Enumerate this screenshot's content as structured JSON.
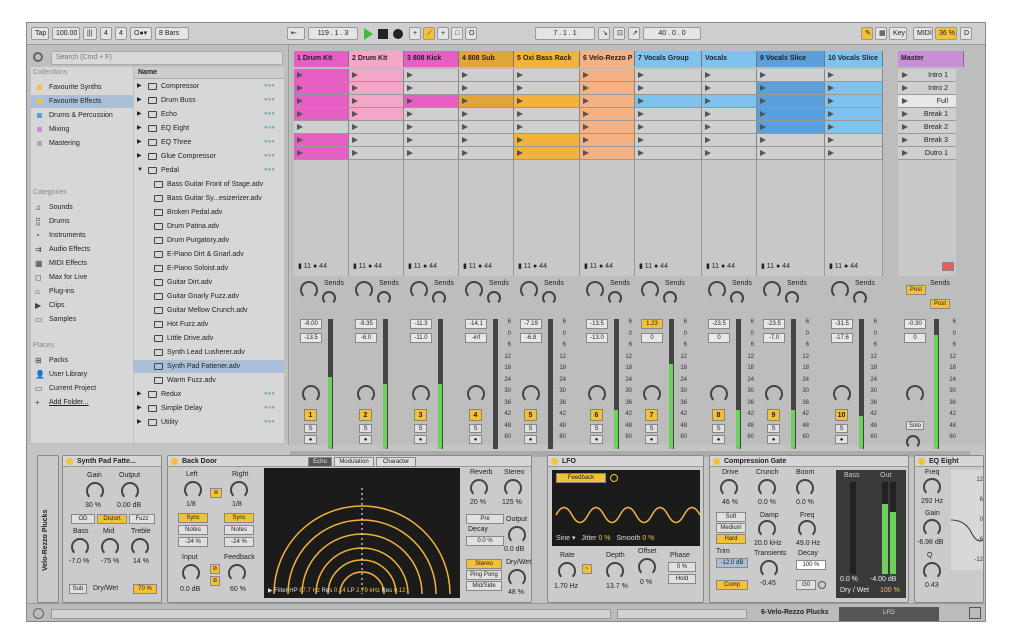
{
  "toolbar": {
    "tap": "Tap",
    "tempo": "100.00",
    "sig_num": "4",
    "sig_den": "4",
    "quant": "8 Bars",
    "pos": "119 . 1 . 3",
    "pos2": "7 . 1 . 1",
    "loop_len": "40 . 0 . 0",
    "key": "Key",
    "midi": "MIDI",
    "cpu": "36 %",
    "disk": "D"
  },
  "browser": {
    "search_placeholder": "Search (Cmd + F)",
    "collections_title": "Collections",
    "categories_title": "Categories",
    "places_title": "Places",
    "name_header": "Name",
    "collections": [
      {
        "label": "Favourite Synths",
        "color": "#f3c13a"
      },
      {
        "label": "Favourite Effects",
        "color": "#f3c13a"
      },
      {
        "label": "Drums & Percussion",
        "color": "#5aa0dc"
      },
      {
        "label": "Mixing",
        "color": "#c78fd8"
      },
      {
        "label": "Mastering",
        "color": "#aaa"
      }
    ],
    "categories": [
      "Sounds",
      "Drums",
      "Instruments",
      "Audio Effects",
      "MIDI Effects",
      "Max for Live",
      "Plug-ins",
      "Clips",
      "Samples"
    ],
    "places": [
      "Packs",
      "User Library",
      "Current Project",
      "Add Folder..."
    ],
    "files": [
      {
        "name": "Compressor",
        "lvl": 0,
        "folder": true
      },
      {
        "name": "Drum Buss",
        "lvl": 0,
        "folder": true
      },
      {
        "name": "Echo",
        "lvl": 0,
        "folder": true
      },
      {
        "name": "EQ Eight",
        "lvl": 0,
        "folder": true
      },
      {
        "name": "EQ Three",
        "lvl": 0,
        "folder": true
      },
      {
        "name": "Glue Compressor",
        "lvl": 0,
        "folder": true
      },
      {
        "name": "Pedal",
        "lvl": 0,
        "folder": true,
        "open": true
      },
      {
        "name": "Bass Guitar Front of Stage.adv",
        "lvl": 1
      },
      {
        "name": "Bass Guitar Sy...esizerizer.adv",
        "lvl": 1
      },
      {
        "name": "Broken Pedal.adv",
        "lvl": 1
      },
      {
        "name": "Drum Patina.adv",
        "lvl": 1
      },
      {
        "name": "Drum Purgatory.adv",
        "lvl": 1
      },
      {
        "name": "E-Piano Dirt & Gnarl.adv",
        "lvl": 1
      },
      {
        "name": "E-Piano Soloist.adv",
        "lvl": 1
      },
      {
        "name": "Guitar Dirt.adv",
        "lvl": 1
      },
      {
        "name": "Guitar Gnarly Fuzz.adv",
        "lvl": 1
      },
      {
        "name": "Guitar Mellow Crunch.adv",
        "lvl": 1
      },
      {
        "name": "Hot Fuzz.adv",
        "lvl": 1
      },
      {
        "name": "Little Drive.adv",
        "lvl": 1
      },
      {
        "name": "Synth Lead Lusherer.adv",
        "lvl": 1
      },
      {
        "name": "Synth Pad Fattener.adv",
        "lvl": 1,
        "sel": true
      },
      {
        "name": "Warm Fuzz.adv",
        "lvl": 1
      },
      {
        "name": "Redux",
        "lvl": 0,
        "folder": true
      },
      {
        "name": "Simple Delay",
        "lvl": 0,
        "folder": true
      },
      {
        "name": "Utility",
        "lvl": 0,
        "folder": true
      }
    ]
  },
  "tracks": [
    {
      "name": "1 Drum Kit",
      "color": "#e65fc4",
      "vol": "-8.00",
      "pk": "-13.5",
      "num": "1",
      "clips": [
        1,
        1,
        1,
        1,
        0,
        1,
        1
      ],
      "meter": 0.55
    },
    {
      "name": "2 Drum Kit",
      "color": "#f4a6c9",
      "vol": "-9.35",
      "pk": "-6.0",
      "num": "2",
      "clips": [
        1,
        1,
        1,
        1,
        0,
        0,
        0
      ],
      "meter": 0.5
    },
    {
      "name": "3 808 Kick",
      "color": "#e65fc4",
      "vol": "-11.3",
      "pk": "-11.0",
      "num": "3",
      "clips": [
        0,
        0,
        1,
        0,
        0,
        0,
        0
      ],
      "meter": 0.5
    },
    {
      "name": "4 808 Sub",
      "color": "#e0a43a",
      "vol": "-14.1",
      "pk": "-inf",
      "num": "4",
      "clips": [
        0,
        0,
        1,
        0,
        0,
        0,
        0
      ],
      "meter": 0
    },
    {
      "name": "5 Oxi Bass Rack",
      "color": "#f3b23a",
      "vol": "-7.19",
      "pk": "-6.8",
      "num": "5",
      "clips": [
        0,
        0,
        1,
        0,
        0,
        1,
        1
      ],
      "meter": 0
    },
    {
      "name": "6 Velo-Rezzo P",
      "color": "#f4b183",
      "vol": "-13.5",
      "pk": "-13.0",
      "num": "6",
      "clips": [
        1,
        1,
        1,
        1,
        1,
        1,
        1
      ],
      "meter": 0.3
    },
    {
      "name": "7 Vocals Group",
      "color": "#7ec3f0",
      "vol": "1.23",
      "pk": "0",
      "num": "7",
      "clips": [
        0,
        0,
        1,
        0,
        0,
        0,
        0
      ],
      "meter": 0.65
    },
    {
      "name": "Vocals",
      "color": "#7ec3f0",
      "vol": "-23.5",
      "pk": "0",
      "num": "8",
      "clips": [
        0,
        0,
        1,
        0,
        0,
        0,
        0
      ],
      "meter": 0.3
    },
    {
      "name": "9 Vocals Slice",
      "color": "#5aa0dc",
      "vol": "-23.5",
      "pk": "-7.0",
      "num": "9",
      "clips": [
        0,
        1,
        1,
        1,
        1,
        0,
        0
      ],
      "meter": 0.3
    },
    {
      "name": "10 Vocals Slice",
      "color": "#7ec3f0",
      "vol": "-31.5",
      "pk": "-17.6",
      "num": "10",
      "clips": [
        0,
        1,
        1,
        1,
        1,
        0,
        0
      ],
      "meter": 0.25
    }
  ],
  "master": {
    "name": "Master",
    "vol": "-0.30",
    "pk": "0",
    "scenes": [
      "Intro 1",
      "Intro 2",
      "Full",
      "Break 1",
      "Break 2",
      "Break 3",
      "Outro 1"
    ]
  },
  "mix_labels": {
    "sends": "Sends",
    "post": "Post",
    "s": "S",
    "solo": "Solo",
    "scale": [
      "6",
      "0",
      "6",
      "12",
      "18",
      "24",
      "30",
      "36",
      "42",
      "48",
      "60"
    ]
  },
  "dev_rack": {
    "title": "Velo-Rezzo Plucks"
  },
  "dev_fatt": {
    "title": "Synth Pad Fatte...",
    "gain_l": "Gain",
    "out_l": "Output",
    "gain": "30 %",
    "out": "0.00 dB",
    "od": "OD",
    "distort": "Distort",
    "fuzz": "Fuzz",
    "bass_l": "Bass",
    "mid_l": "Mid",
    "treble_l": "Treble",
    "bass": "-7.0 %",
    "mid": "-75 %",
    "treble": "14 %",
    "sub": "Sub",
    "drywet_l": "Dry/Wet",
    "drywet": "70 %"
  },
  "dev_echo": {
    "title": "Back Door",
    "tab1": "Echo",
    "tab2": "Modulation",
    "tab3": "Character",
    "left": "Left",
    "right": "Right",
    "lv": "1/8",
    "rv": "1/8",
    "sync": "Sync",
    "notes": "Notes",
    "lp": "-24 %",
    "rp": "-24 %",
    "input_l": "Input",
    "input": "0.0 dB",
    "fb_l": "Feedback",
    "fb": "60 %",
    "reverb_l": "Reverb",
    "reverb": "20 %",
    "stereo_l": "Stereo",
    "stereo": "125 %",
    "pre": "Pre",
    "decay_l": "Decay",
    "decay": "0.0 %",
    "output_l": "Output",
    "output": "0.0 dB",
    "stereo_b": "Stereo",
    "ping": "Ping Pong",
    "midside": "Mid/Side",
    "drywet_l": "Dry/Wet",
    "drywet": "48 %",
    "filter": "Filter HP",
    "hp": "67.7 Hz",
    "res_l": "Res",
    "res1": "0.14",
    "lp_l": "LP",
    "lpv": "2.79 kHz",
    "res2": "0.12"
  },
  "dev_lfo": {
    "title": "LFO",
    "map": "Feedback",
    "wave": "Sine",
    "jitter_l": "Jitter",
    "jitter": "0 %",
    "smooth_l": "Smooth",
    "smooth": "0 %",
    "rate_l": "Rate",
    "rate": "1.70 Hz",
    "depth_l": "Depth",
    "depth": "13.7 %",
    "offset_l": "Offset",
    "offset": "0 %",
    "phase_l": "Phase",
    "phase": "0 %",
    "hold": "Hold"
  },
  "dev_comp": {
    "title": "Compression Gate",
    "drive_l": "Drive",
    "drive": "46 %",
    "crunch_l": "Crunch",
    "crunch": "0.0 %",
    "boom_l": "Boom",
    "boom": "0.0 %",
    "soft": "Soft",
    "medium": "Medium",
    "hard": "Hard",
    "damp_l": "Damp",
    "damp": "20.0 kHz",
    "freq_l": "Freq",
    "freq": "49.0 Hz",
    "trim_l": "Trim",
    "trim": "-12.0 dB",
    "trans_l": "Transients",
    "trans": "-0.45",
    "decay_l": "Decay",
    "decay": "100 %",
    "comp": "Comp",
    "g0": "G0",
    "bass_l": "Bass",
    "out_l": "Out",
    "bassv": "0.0 %",
    "outv": "-4.00 dB",
    "drywet": "Dry / Wet",
    "dwv": "100 %"
  },
  "dev_eq": {
    "title": "EQ Eight",
    "freq_l": "Freq",
    "freq": "292 Hz",
    "gain_l": "Gain",
    "gain": "-6.98 dB",
    "q_l": "Q",
    "q": "0.43",
    "scale": [
      "12",
      "6",
      "0",
      "-6",
      "-12"
    ]
  },
  "status": {
    "track": "6-Velo-Rezzo Plucks",
    "lfo": "LFO"
  }
}
